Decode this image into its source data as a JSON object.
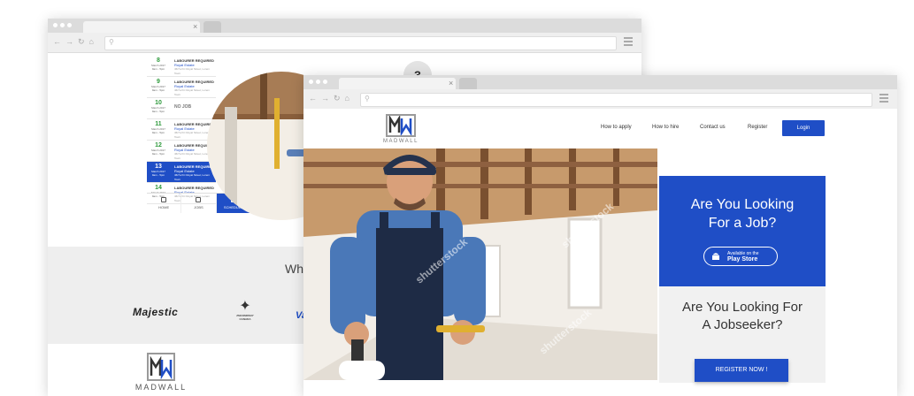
{
  "back_window": {
    "schedule": [
      {
        "day": "8",
        "sub": "March 2017",
        "time": "9am - 5pm",
        "title": "LABOURER REQUIRED",
        "company": "Royal Estate",
        "address": "46/7a KC Royal Street, Lorem Town"
      },
      {
        "day": "9",
        "sub": "March 2017",
        "time": "9am - 5pm",
        "title": "LABOURER REQUIRED",
        "company": "Royal Estate",
        "address": "46/7a KC Royal Street, Lorem Town"
      },
      {
        "day": "10",
        "sub": "March 2017",
        "time": "9am - 5pm",
        "title": "NO JOB",
        "company": "",
        "address": ""
      },
      {
        "day": "11",
        "sub": "March 2017",
        "time": "9am - 5pm",
        "title": "LABOURER REQUIRED",
        "company": "Royal Estate",
        "address": "46/7a KC Royal Street, Lorem Town"
      },
      {
        "day": "12",
        "sub": "March 2017",
        "time": "9am - 5pm",
        "title": "LABOURER REQUIRED",
        "company": "Royal Estate",
        "address": "46/7a KC Royal Street, Lorem Town"
      },
      {
        "day": "13",
        "sub": "March 2017",
        "time": "9am - 5pm",
        "title": "LABOURER REQUIRED",
        "company": "Royal Estate",
        "address": "46/7a KC Royal Street, Lorem Town"
      },
      {
        "day": "14",
        "sub": "March 2017",
        "time": "9am - 5pm",
        "title": "LABOURER REQUIRED",
        "company": "Royal Estate",
        "address": "46/7a KC Royal Street, Lorem Town"
      }
    ],
    "app_nav": [
      "HOME",
      "JOBS",
      "SCHEDULE"
    ],
    "step_number": "3",
    "who_heading": "Who",
    "client_logos": {
      "majestic": "Majestic",
      "zm": "ZMCOMPANY",
      "zm_sub": "CANADA",
      "va": "Va"
    },
    "footer_logo": "MADWALL"
  },
  "front_window": {
    "logo_text": "MADWALL",
    "nav": [
      "How to apply",
      "How to hire",
      "Contact us",
      "Register"
    ],
    "login_label": "Login",
    "watermark": "shutterstock",
    "job_card": {
      "line1": "Are You Looking",
      "line2": "For a Job?",
      "store_line1": "Available on the",
      "store_line2": "Play Store"
    },
    "seeker_card": {
      "line1": "Are You Looking For",
      "line2": "A Jobseeker?",
      "button": "REGISTER NOW !"
    }
  },
  "colors": {
    "accent": "#1f4ec6",
    "green": "#2e9a3c"
  }
}
